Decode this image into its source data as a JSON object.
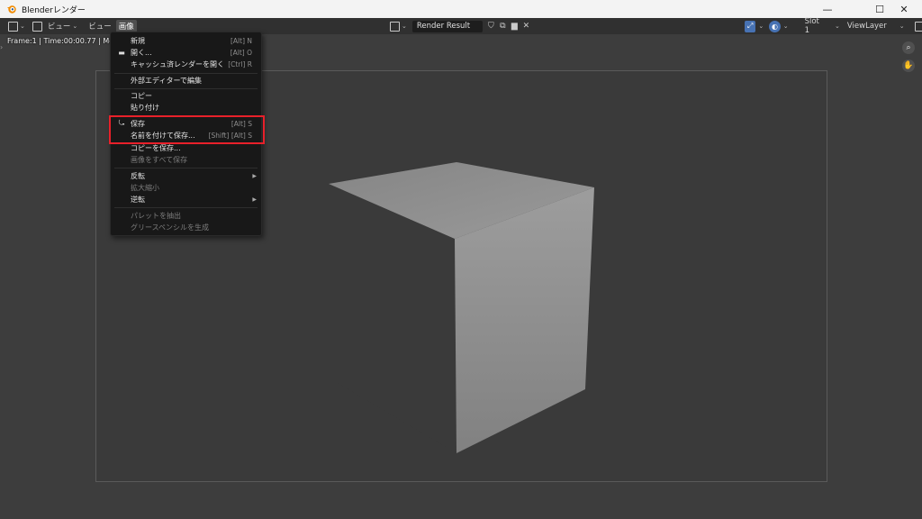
{
  "window": {
    "title": "Blenderレンダー",
    "controls": {
      "minimize": "—",
      "maximize": "☐",
      "close": "✕"
    }
  },
  "header": {
    "menus": [
      "ビュー",
      "ビュー",
      "画像"
    ],
    "image_name": "Render Result",
    "slot": "Slot 1",
    "view_layer": "ViewLayer"
  },
  "info": "Frame:1 | Time:00:00.77 | Mem:",
  "image_menu": {
    "items": [
      {
        "label": "新規",
        "shortcut": "[Alt] N"
      },
      {
        "label": "開く...",
        "shortcut": "[Alt] O",
        "icon": "folder-icon"
      },
      {
        "label": "キャッシュ済レンダーを開く",
        "shortcut": "[Ctrl] R"
      },
      {
        "label": "外部エディターで編集",
        "shortcut": ""
      },
      {
        "label": "コピー",
        "shortcut": ""
      },
      {
        "label": "貼り付け",
        "shortcut": ""
      },
      {
        "label": "保存",
        "shortcut": "[Alt] S",
        "icon": "save-icon"
      },
      {
        "label": "名前を付けて保存...",
        "shortcut": "[Shift] [Alt] S"
      },
      {
        "label": "コピーを保存...",
        "shortcut": ""
      },
      {
        "label": "画像をすべて保存",
        "shortcut": "",
        "disabled": true
      },
      {
        "label": "反転",
        "shortcut": "",
        "submenu": true
      },
      {
        "label": "拡大縮小",
        "shortcut": "",
        "disabled": true
      },
      {
        "label": "逆転",
        "shortcut": "",
        "submenu": true
      },
      {
        "label": "パレットを抽出",
        "shortcut": "",
        "disabled": true
      },
      {
        "label": "グリースペンシルを生成",
        "shortcut": "",
        "disabled": true
      }
    ]
  },
  "colors": {
    "highlight": "#e8202a",
    "accent": "#4772b3"
  }
}
